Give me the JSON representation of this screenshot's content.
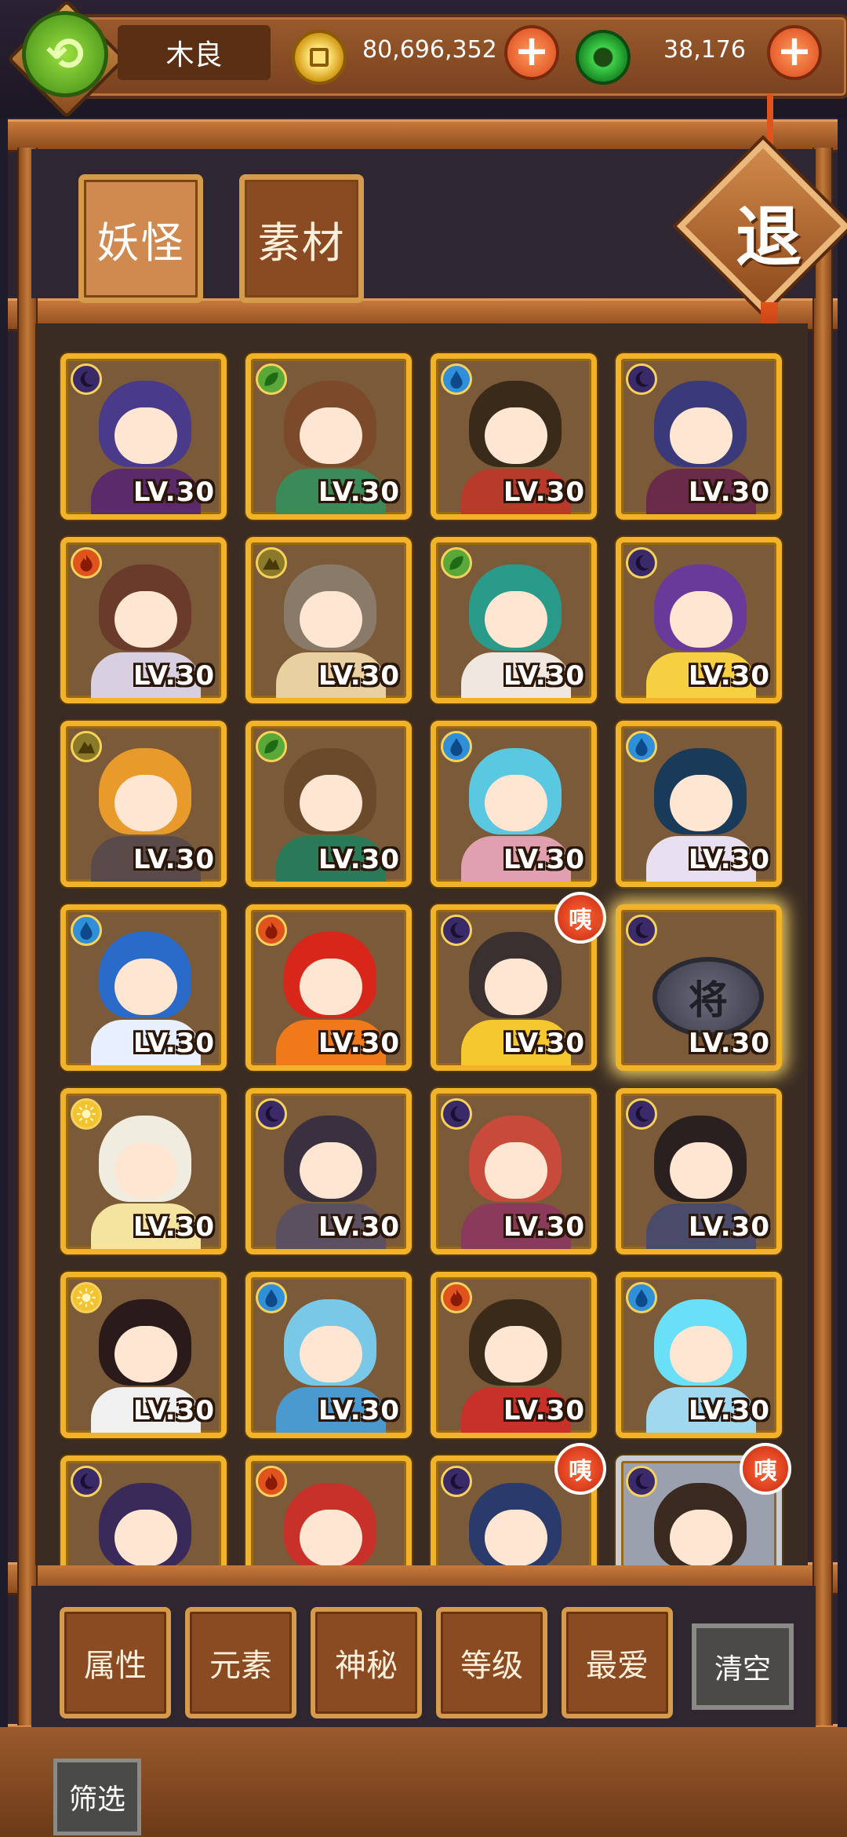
{
  "header": {
    "player_name": "木良",
    "coins": "80,696,352",
    "jade": "38,176",
    "plus_label": "+"
  },
  "tabs": [
    {
      "label": "妖怪",
      "active": true
    },
    {
      "label": "素材",
      "active": false
    }
  ],
  "exit_label": "退",
  "new_badge_label": "咦",
  "cards": [
    {
      "element": "dark",
      "level": "LV.30",
      "hair": "#4a3a8a",
      "body": "#5a2a6a",
      "new": false
    },
    {
      "element": "wood",
      "level": "LV.30",
      "hair": "#7a4a2a",
      "body": "#3a8a5a",
      "new": false
    },
    {
      "element": "water",
      "level": "LV.30",
      "hair": "#3a2a1a",
      "body": "#b83a2a",
      "new": false
    },
    {
      "element": "dark",
      "level": "LV.30",
      "hair": "#3a3a7a",
      "body": "#6a2a4a",
      "new": false
    },
    {
      "element": "fire",
      "level": "LV.30",
      "hair": "#6a3a2a",
      "body": "#d8d0e0",
      "new": false
    },
    {
      "element": "earth",
      "level": "LV.30",
      "hair": "#8a7a6a",
      "body": "#e8d0a0",
      "new": false
    },
    {
      "element": "wood",
      "level": "LV.30",
      "hair": "#2a9a8a",
      "body": "#f0e8e0",
      "new": false
    },
    {
      "element": "dark",
      "level": "LV.30",
      "hair": "#6a3a9a",
      "body": "#f6d040",
      "new": false
    },
    {
      "element": "earth",
      "level": "LV.30",
      "hair": "#e89a2a",
      "body": "#5a4a4a",
      "new": false
    },
    {
      "element": "wood",
      "level": "LV.30",
      "hair": "#6a4a2a",
      "body": "#2a7a5a",
      "new": false
    },
    {
      "element": "water",
      "level": "LV.30",
      "hair": "#5ac8e0",
      "body": "#e0a0b0",
      "new": false
    },
    {
      "element": "water",
      "level": "LV.30",
      "hair": "#1a3a5a",
      "body": "#e8e0f0",
      "new": false
    },
    {
      "element": "water",
      "level": "LV.30",
      "hair": "#2a6ac8",
      "body": "#e8f0ff",
      "new": false
    },
    {
      "element": "fire",
      "level": "LV.30",
      "hair": "#d8261a",
      "body": "#f07a1a",
      "new": false
    },
    {
      "element": "dark",
      "level": "LV.30",
      "hair": "#3a3030",
      "body": "#f6c830",
      "new": true
    },
    {
      "element": "dark",
      "level": "LV.30",
      "hair": "",
      "body": "",
      "chess": "将",
      "new": false
    },
    {
      "element": "light",
      "level": "LV.30",
      "hair": "#f0ece0",
      "body": "#f4e4a0",
      "new": false
    },
    {
      "element": "dark",
      "level": "LV.30",
      "hair": "#3a3040",
      "body": "#5a5060",
      "new": false
    },
    {
      "element": "dark",
      "level": "LV.30",
      "hair": "#c84a3a",
      "body": "#8a3a5a",
      "new": false
    },
    {
      "element": "dark",
      "level": "LV.30",
      "hair": "#2a2020",
      "body": "#4a4a6a",
      "new": false
    },
    {
      "element": "light",
      "level": "LV.30",
      "hair": "#2a1a1a",
      "body": "#f0f0f0",
      "new": false
    },
    {
      "element": "water",
      "level": "LV.30",
      "hair": "#7ac8e8",
      "body": "#4a9ad0",
      "new": false
    },
    {
      "element": "fire",
      "level": "LV.30",
      "hair": "#3a2a1a",
      "body": "#c8302a",
      "new": false
    },
    {
      "element": "water",
      "level": "LV.30",
      "hair": "#6ae0f8",
      "body": "#a0d8f0",
      "new": false
    },
    {
      "element": "dark",
      "level": "",
      "hair": "#3a2a5a",
      "body": "#e04a3a",
      "new": false
    },
    {
      "element": "fire",
      "level": "",
      "hair": "#c8302a",
      "body": "#f0d0b0",
      "new": false
    },
    {
      "element": "dark",
      "level": "",
      "hair": "#2a3a6a",
      "body": "#e8e8f0",
      "new": true
    },
    {
      "element": "dark",
      "level": "",
      "hair": "#3a2a20",
      "body": "#f0e8e0",
      "new": true,
      "silver": true
    }
  ],
  "filters": [
    {
      "label": "属性"
    },
    {
      "label": "元素"
    },
    {
      "label": "神秘"
    },
    {
      "label": "等级"
    },
    {
      "label": "最爱"
    }
  ],
  "clear_label": "清空",
  "screen_label": "筛选",
  "colors": {
    "wood": "#5aa83a",
    "fire": "#e0531c",
    "water": "#2f8fd8",
    "dark": "#3a2a6a",
    "earth": "#8a7a2a",
    "light": "#f2c230",
    "card_border": "#f2b32a"
  }
}
